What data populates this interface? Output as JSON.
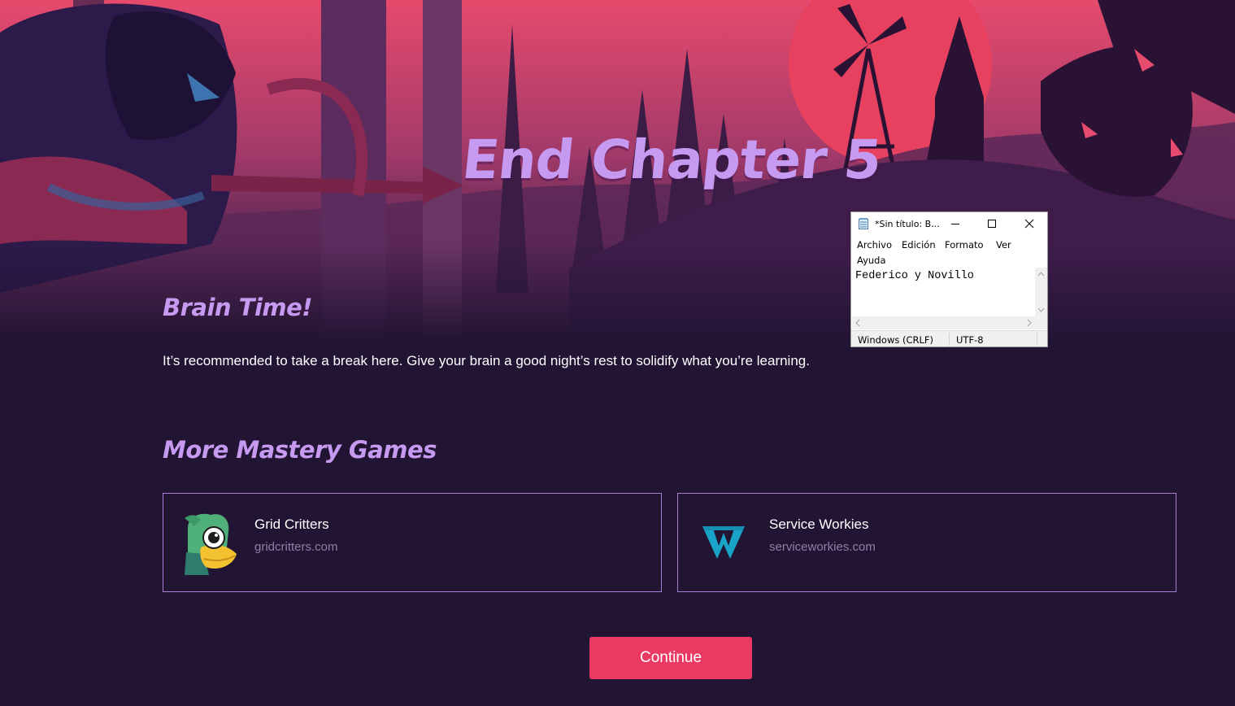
{
  "hero": {
    "title": "End Chapter 5"
  },
  "brain": {
    "heading": "Brain Time!",
    "text": "It’s recommended to take a break here. Give your brain a good night’s rest to solidify what you’re learning."
  },
  "mastery": {
    "heading": "More Mastery Games",
    "games": [
      {
        "name": "Grid Critters",
        "url": "gridcritters.com",
        "icon": "grid-critters-logo"
      },
      {
        "name": "Service Workies",
        "url": "serviceworkies.com",
        "icon": "service-workies-logo"
      }
    ]
  },
  "continue_button": {
    "label": "Continue"
  },
  "notepad": {
    "title": "*Sin título: B...",
    "menu": [
      "Archivo",
      "Edición",
      "Formato",
      "Ver",
      "Ayuda"
    ],
    "content": "Federico y Novillo",
    "status": {
      "line_ending": "Windows (CRLF)",
      "encoding": "UTF-8"
    },
    "controls": [
      "minimize-icon",
      "maximize-icon",
      "close-icon"
    ]
  },
  "colors": {
    "background": "#221433",
    "heading": "#c79af2",
    "accent": "#ea3a64",
    "card_border": "#a87fd6"
  }
}
